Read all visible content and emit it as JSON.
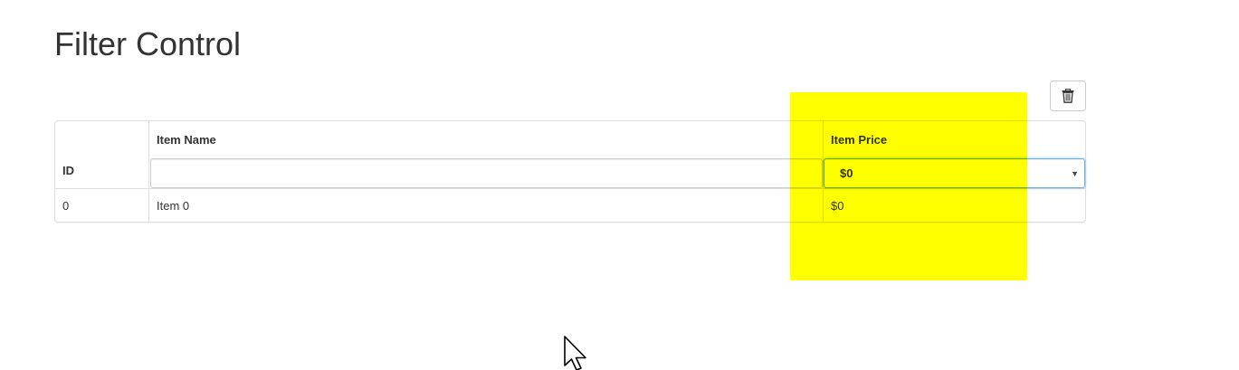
{
  "page": {
    "title": "Filter Control"
  },
  "toolbar": {
    "clear_filters_icon": "trash-icon"
  },
  "table": {
    "columns": [
      {
        "key": "id",
        "label": "ID"
      },
      {
        "key": "name",
        "label": "Item Name"
      },
      {
        "key": "price",
        "label": "Item Price"
      }
    ],
    "filters": {
      "name_value": "",
      "price_selected": "$0"
    },
    "rows": [
      {
        "id": "0",
        "name": "Item 0",
        "price": "$0"
      }
    ]
  },
  "colors": {
    "highlight": "#ffff00",
    "border": "#dddddd",
    "focus_border": "#66afe9",
    "text": "#333333"
  },
  "overlay": {
    "cursor_icon": "mouse-pointer-icon"
  }
}
